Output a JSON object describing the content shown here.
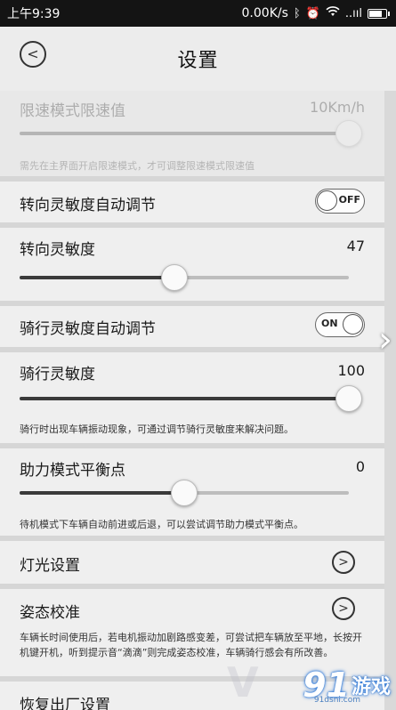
{
  "status_bar": {
    "time": "上午9:39",
    "net_speed": "0.00K/s",
    "carrier_signal": "..ııl",
    "battery_level": 0.85
  },
  "header": {
    "title": "设置"
  },
  "speed_limit": {
    "label": "限速模式限速值",
    "value": "10Km/h",
    "note": "需先在主界面开启限速模式，才可调整限速模式限速值",
    "slider_position": 1.0
  },
  "steer_auto": {
    "label": "转向灵敏度自动调节",
    "toggle_text": "OFF"
  },
  "steer_sens": {
    "label": "转向灵敏度",
    "value": "47",
    "slider_position": 0.47
  },
  "ride_auto": {
    "label": "骑行灵敏度自动调节",
    "toggle_text": "ON"
  },
  "ride_sens": {
    "label": "骑行灵敏度",
    "value": "100",
    "slider_position": 1.0,
    "note": "骑行时出现车辆振动现象，可通过调节骑行灵敏度来解决问题。"
  },
  "assist_balance": {
    "label": "助力模式平衡点",
    "value": "0",
    "slider_position": 0.5,
    "note": "待机模式下车辆自动前进或后退，可以尝试调节助力模式平衡点。"
  },
  "lights": {
    "label": "灯光设置"
  },
  "calibration": {
    "label": "姿态校准",
    "note": "车辆长时间使用后，若电机振动加剧路感变差，可尝试把车辆放至平地，长按开机键开机，听到提示音“滴滴”则完成姿态校准，车辆骑行感会有所改善。"
  },
  "factory_reset": {
    "label": "恢复出厂设置"
  },
  "watermark": {
    "logo_num": "91",
    "logo_text": "游戏",
    "logo_sub": "91dsni.com"
  }
}
